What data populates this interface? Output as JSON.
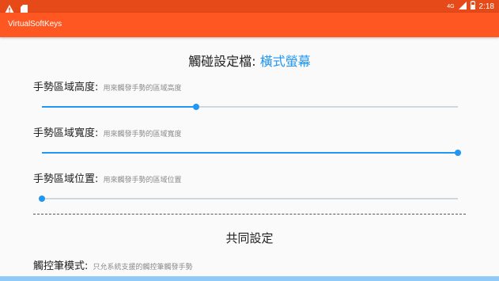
{
  "status_bar": {
    "time": "2:18",
    "network_label": "4G",
    "icons": [
      "warning-icon",
      "sd-card-icon",
      "signal-icon",
      "battery-icon"
    ]
  },
  "app_bar": {
    "title": "VirtualSoftKeys"
  },
  "colors": {
    "status_bar": "#e64a19",
    "app_bar": "#ff5722",
    "accent": "#2196f3",
    "track": "#cfd8dc",
    "bottom_bar": "#90caf9"
  },
  "touch_settings": {
    "title_prefix": "觸碰設定檔: ",
    "title_value": "橫式螢幕",
    "rows": [
      {
        "label": "手勢區域高度:",
        "description": "用來觸發手勢的區域高度",
        "value": 0.37
      },
      {
        "label": "手勢區域寬度:",
        "description": "用來觸發手勢的區域寬度",
        "value": 1.0
      },
      {
        "label": "手勢區域位置:",
        "description": "用來觸發手勢的區域位置",
        "value": 0.0
      }
    ]
  },
  "common_settings": {
    "title": "共同設定",
    "stylus_mode_label": "觸控筆模式:",
    "stylus_mode_description": "只允系統支援的觸控筆觸發手勢"
  }
}
